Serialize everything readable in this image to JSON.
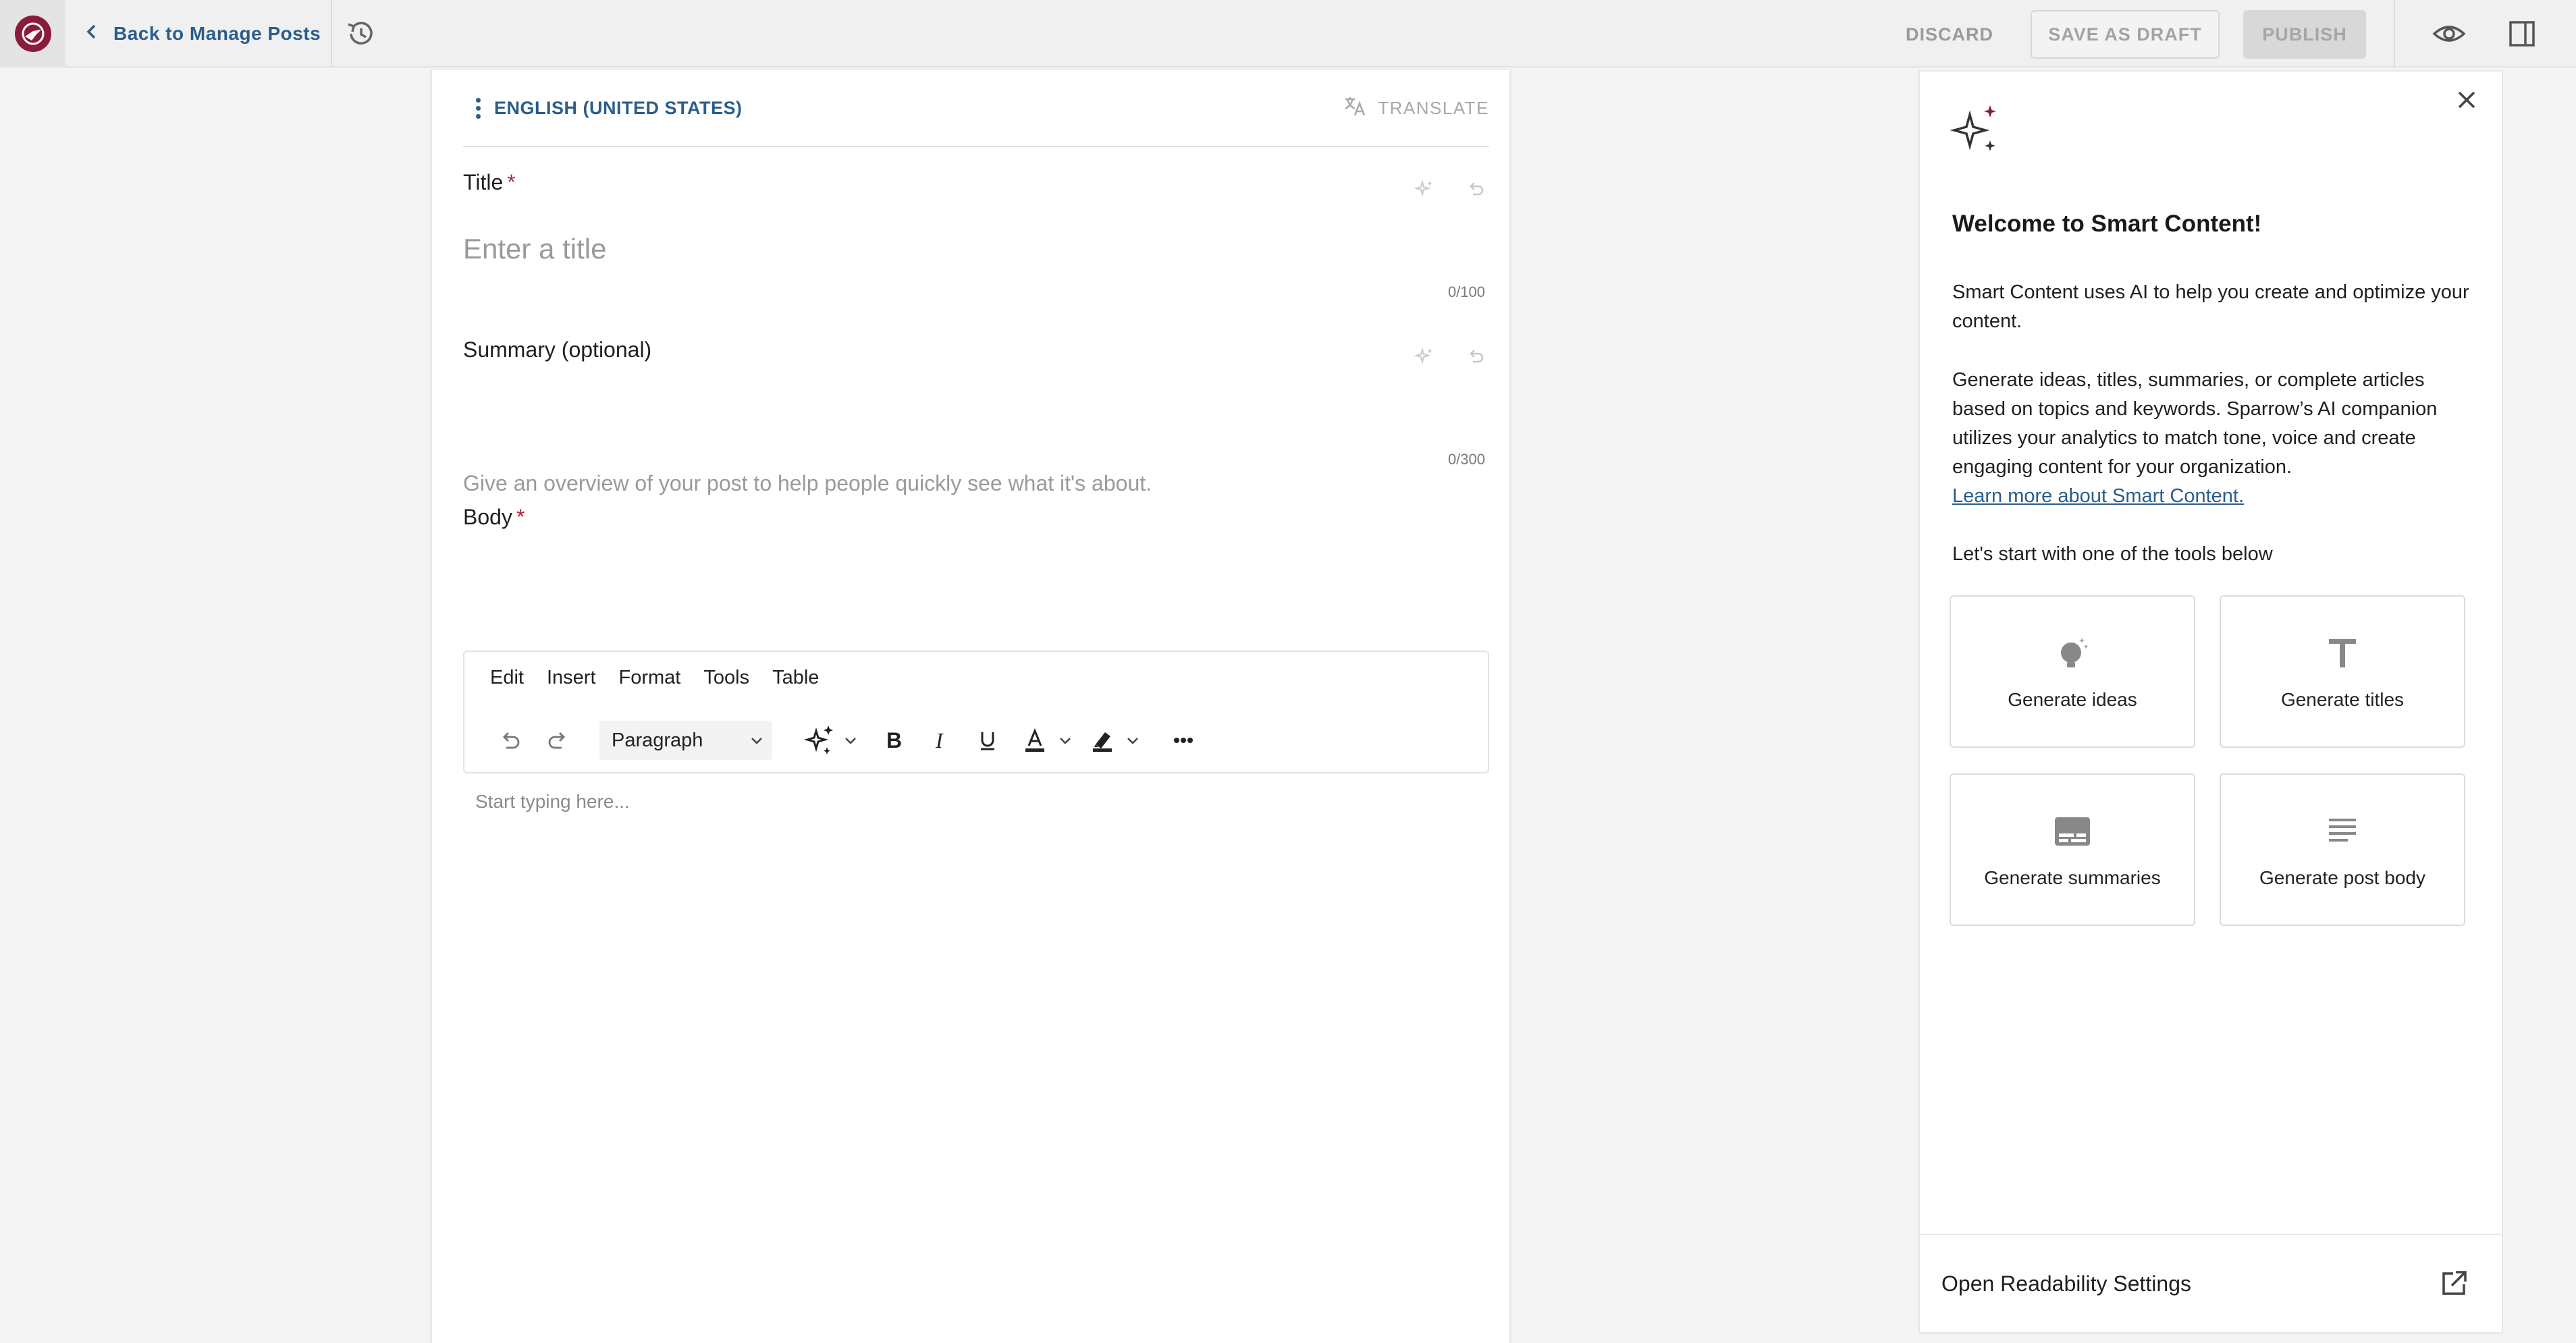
{
  "topbar": {
    "back_label": "Back to Manage Posts",
    "discard_label": "DISCARD",
    "draft_label": "SAVE AS DRAFT",
    "publish_label": "PUBLISH"
  },
  "editor": {
    "language": "ENGLISH (UNITED STATES)",
    "translate_label": "TRANSLATE",
    "title": {
      "label": "Title",
      "required_mark": "*",
      "placeholder": "Enter a title",
      "counter": "0/100"
    },
    "summary": {
      "label": "Summary (optional)",
      "placeholder": "Give an overview of your post to help people quickly see what it's about.",
      "counter": "0/300"
    },
    "body": {
      "label": "Body",
      "required_mark": "*",
      "menu": [
        "Edit",
        "Insert",
        "Format",
        "Tools",
        "Table"
      ],
      "block_format": "Paragraph",
      "placeholder": "Start typing here..."
    }
  },
  "smart_panel": {
    "title": "Welcome to Smart Content!",
    "intro": "Smart Content uses AI to help you create and optimize your content.",
    "description": "Generate ideas, titles, summaries, or complete articles based on topics and keywords. Sparrow’s AI companion utilizes your analytics to match tone, voice and create engaging content for your organization.",
    "learn_more": "Learn more about Smart Content.",
    "start_text": "Let's start with one of the tools below",
    "tools": [
      {
        "label": "Generate ideas",
        "icon": "lightbulb-icon"
      },
      {
        "label": "Generate titles",
        "icon": "title-t-icon"
      },
      {
        "label": "Generate summaries",
        "icon": "summary-icon"
      },
      {
        "label": "Generate post body",
        "icon": "text-lines-icon"
      }
    ],
    "readability_label": "Open Readability Settings"
  },
  "colors": {
    "accent": "#2a5d8a",
    "brand": "#8a1c3a",
    "required": "#b3243e"
  }
}
